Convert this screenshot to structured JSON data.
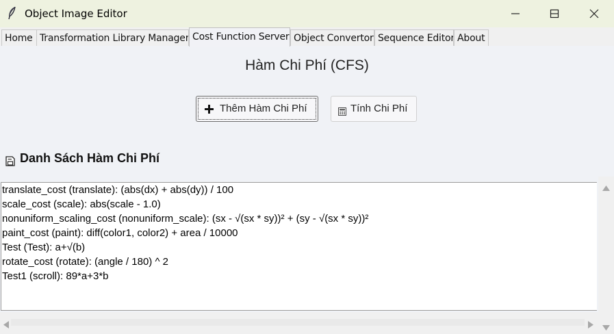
{
  "window": {
    "title": "Object Image Editor",
    "icon": "feather-icon",
    "controls": [
      "minimize-icon",
      "maximize-icon",
      "close-icon"
    ]
  },
  "tabs": [
    {
      "label": "Home",
      "active": false
    },
    {
      "label": "Transformation Library Manager",
      "active": false
    },
    {
      "label": "Cost Function Server",
      "active": true
    },
    {
      "label": "Object Convertor",
      "active": false
    },
    {
      "label": "Sequence Editor",
      "active": false
    },
    {
      "label": "About",
      "active": false
    }
  ],
  "main": {
    "heading": "Hàm Chi Phí (CFS)",
    "add_button": {
      "label": "Thêm Hàm Chi Phí",
      "icon": "plus-icon"
    },
    "calc_button": {
      "label": "Tính Chi Phí",
      "icon": "calculator-icon"
    },
    "section_title": "Danh Sách Hàm Chi Phí",
    "section_icon": "save-icon",
    "list_items": [
      "translate_cost (translate): (abs(dx) + abs(dy)) / 100",
      "scale_cost (scale): abs(scale - 1.0)",
      "nonuniform_scaling_cost (nonuniform_scale): (sx - √(sx * sy))² + (sy - √(sx * sy))²",
      "paint_cost (paint): diff(color1, color2) + area / 10000",
      "Test (Test): a+√(b)",
      "rotate_cost (rotate): (angle / 180) ^ 2",
      "Test1 (scroll): 89*a+3*b"
    ]
  },
  "colors": {
    "titlebar_bg": "#eef2e0",
    "panel_bg": "#f0f2f6",
    "list_bg": "#ffffff"
  }
}
